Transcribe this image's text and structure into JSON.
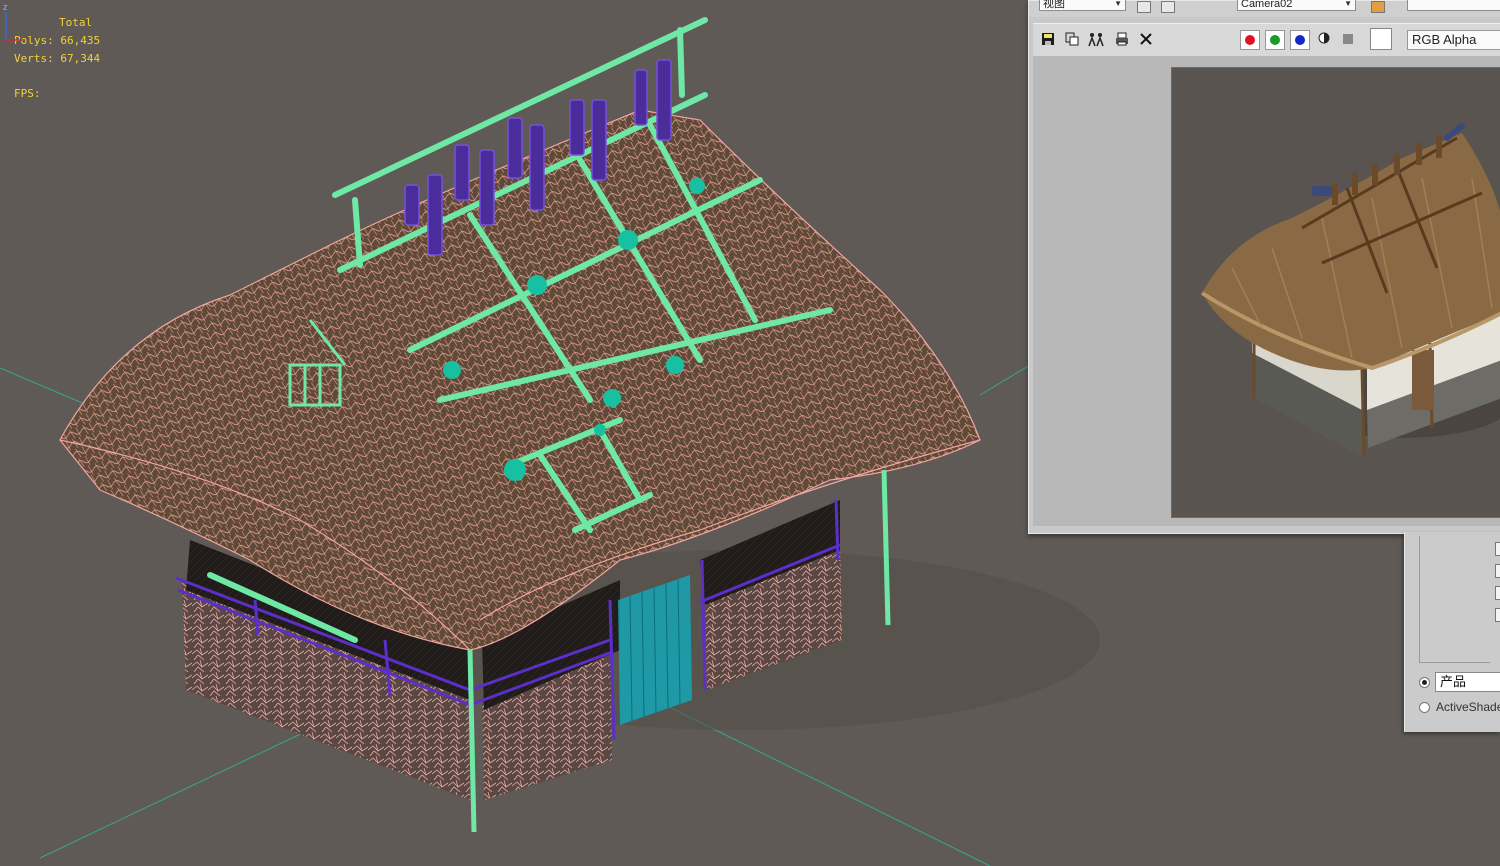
{
  "viewport": {
    "stats": {
      "title": "Total",
      "polys_label": "Polys:",
      "polys_value": "66,435",
      "verts_label": "Verts:",
      "verts_value": "67,344",
      "fps_label": "FPS:"
    },
    "axis_label": "z",
    "colors": {
      "background": "#5f5a55",
      "thatch_wire": "#f0a5a0",
      "beam_wire": "#6fe8a6",
      "post_wire": "#5b2fc8",
      "door_wire": "#16a6b6",
      "grid": "#2fb8a0"
    }
  },
  "render_window": {
    "area_dropdown": "视图",
    "camera_dropdown": "Camera02",
    "channel_dropdown": "RGB Alpha",
    "tools": [
      "save-icon",
      "clone-icon",
      "people-icon",
      "print-icon",
      "close-icon"
    ],
    "channels": {
      "red": "#e0141e",
      "green": "#1a9a2a",
      "blue": "#1428c8"
    }
  },
  "settings_panel": {
    "production_value": "产品",
    "activeshade_label": "ActiveShade"
  }
}
